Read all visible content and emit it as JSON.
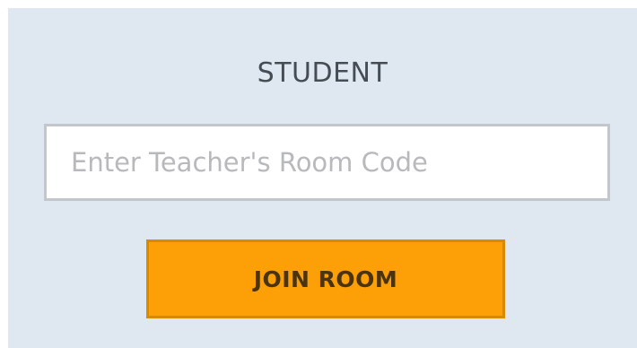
{
  "panel": {
    "title": "STUDENT",
    "room_code_input": {
      "value": "",
      "placeholder": "Enter Teacher's Room Code"
    },
    "join_button_label": "JOIN ROOM"
  },
  "colors": {
    "panel_background": "#dfe8f1",
    "button_background": "#fd9f07",
    "button_border": "#d98a00",
    "input_border": "#c3c6ca"
  }
}
